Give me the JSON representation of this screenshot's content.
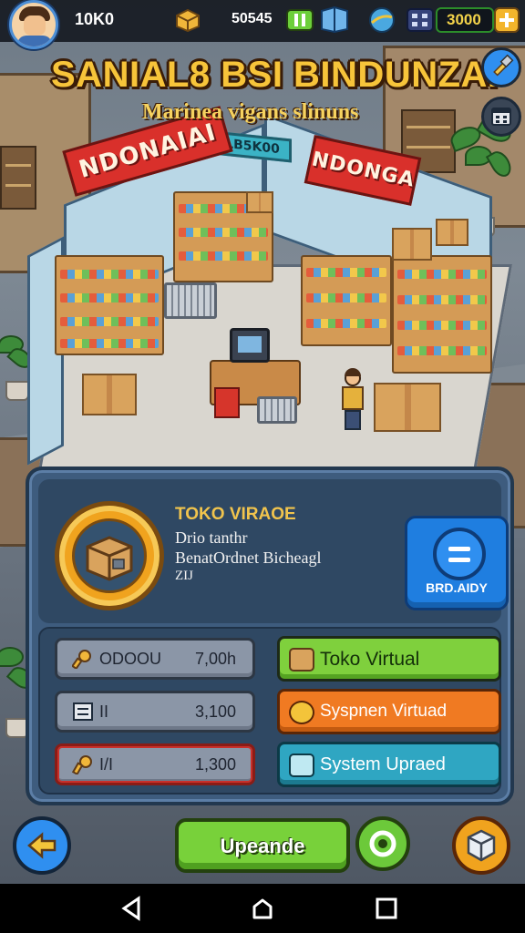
{
  "top_bar": {
    "level": "10K0",
    "box_count": "50545",
    "currency": "3000"
  },
  "title": "SANIAL8 BSI BINDUNZAI",
  "subtitle": "Marinea vigans slinuns",
  "store_signs": {
    "left": "NDONAIAI",
    "right": "NDONGA",
    "center": "LB5K00"
  },
  "item_card": {
    "title": "TOKO VIRAOE",
    "line1": "Drio tanthr",
    "line2": "BenatOrdnet Bicheagl",
    "line3": "ZIJ",
    "ready_label": "BRD.AIDY"
  },
  "stats": [
    {
      "key": "ODOOU",
      "value": "7,00h"
    },
    {
      "key": "II",
      "value": "3,100"
    },
    {
      "key": "I/I",
      "value": "1,300"
    }
  ],
  "actions": [
    {
      "label": "Toko  Virtual"
    },
    {
      "label": "Syspnen Virtuad"
    },
    {
      "label": "System Upraed"
    }
  ],
  "upgrade_label": "Upeande",
  "colors": {
    "accent_gold": "#f7c43a",
    "panel_bg": "#3e5c7e",
    "action_green": "#7fd03d",
    "action_orange": "#f07a22",
    "action_teal": "#2fa6c2",
    "ready_blue": "#1f7ee0"
  }
}
